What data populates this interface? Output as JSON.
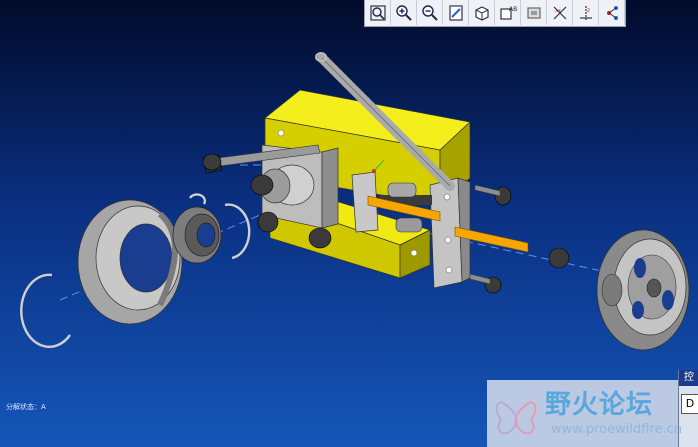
{
  "toolbar": {
    "buttons": [
      {
        "id": "refit",
        "icon": "zoom-fit-icon"
      },
      {
        "id": "zoom-in",
        "icon": "zoom-in-icon"
      },
      {
        "id": "zoom-out",
        "icon": "zoom-out-icon"
      },
      {
        "id": "repaint",
        "icon": "repaint-icon"
      },
      {
        "id": "orient",
        "icon": "orient-cube-icon"
      },
      {
        "id": "saved-views",
        "icon": "saved-views-icon"
      },
      {
        "id": "model-display",
        "icon": "model-display-icon"
      },
      {
        "id": "datum-planes",
        "icon": "datum-planes-icon"
      },
      {
        "id": "datum-axes",
        "icon": "datum-axes-icon"
      },
      {
        "id": "spin-center",
        "icon": "spin-center-icon"
      }
    ]
  },
  "status": {
    "text": "分解状态：A"
  },
  "side_panel": {
    "tab_label": "控",
    "button_label": "D"
  },
  "watermark": {
    "title": "野火论坛",
    "url": "www.proewildfire.cn"
  },
  "colors": {
    "background_top": "#010a2a",
    "background_bottom": "#1556b8",
    "block_yellow": "#e8e000",
    "part_gray": "#b8b8b8",
    "rod_orange": "#f5a500",
    "axis_line": "#4b7dff"
  }
}
